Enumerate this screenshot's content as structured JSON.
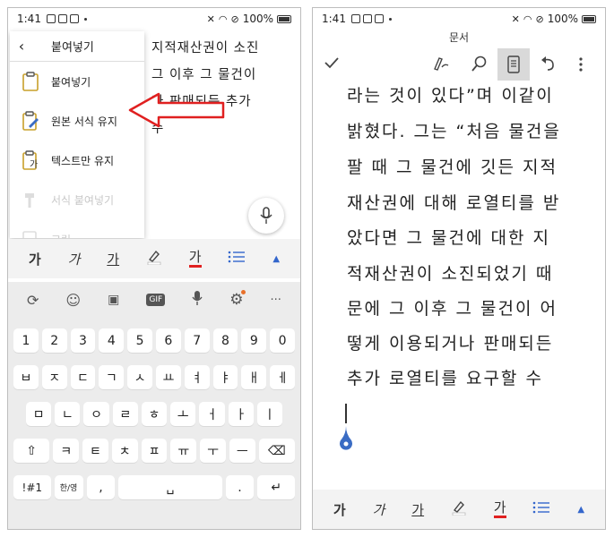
{
  "status_bar": {
    "time": "1:41",
    "battery": "100%"
  },
  "left_screen": {
    "doc_lines": [
      "지적재산권이 소진",
      "그 이후 그 물건이",
      "나 판매되든 추가",
      "수"
    ],
    "paste_menu": {
      "back_icon": "back-arrow-icon",
      "title": "붙여넣기",
      "items": [
        {
          "label": "붙여넣기",
          "icon": "clipboard-icon",
          "enabled": true
        },
        {
          "label": "원본 서식 유지",
          "icon": "clipboard-format-icon",
          "enabled": true
        },
        {
          "label": "텍스트만 유지",
          "icon": "clipboard-text-icon",
          "enabled": true
        },
        {
          "label": "서식 붙여넣기",
          "icon": "format-painter-icon",
          "enabled": false
        },
        {
          "label": "그림",
          "icon": "clipboard-image-icon",
          "enabled": false
        }
      ]
    },
    "annotation_arrow_color": "#e02020",
    "keyboard": {
      "toolbar_icons": [
        "rotate-icon",
        "emoji-icon",
        "sticker-icon",
        "gif-icon",
        "mic-icon",
        "gear-icon",
        "more-icon"
      ],
      "gif_label": "GIF",
      "more_label": "···",
      "rows": [
        [
          "1",
          "2",
          "3",
          "4",
          "5",
          "6",
          "7",
          "8",
          "9",
          "0"
        ],
        [
          "ㅂ",
          "ㅈ",
          "ㄷ",
          "ㄱ",
          "ㅅ",
          "ㅛ",
          "ㅕ",
          "ㅑ",
          "ㅐ",
          "ㅔ"
        ],
        [
          "ㅁ",
          "ㄴ",
          "ㅇ",
          "ㄹ",
          "ㅎ",
          "ㅗ",
          "ㅓ",
          "ㅏ",
          "ㅣ"
        ],
        [
          "⇧",
          "ㅋ",
          "ㅌ",
          "ㅊ",
          "ㅍ",
          "ㅠ",
          "ㅜ",
          "ㅡ",
          "⌫"
        ],
        [
          "!#1",
          "한/영",
          ",",
          "␣",
          ".",
          "↵"
        ]
      ]
    }
  },
  "format_bar": {
    "bold": "가",
    "italic": "가",
    "underline": "가",
    "color": "가",
    "list_icon": "list-icon",
    "expand_icon": "▲"
  },
  "right_screen": {
    "title": "문서",
    "toolbar_icons": [
      "check-icon",
      "pen-icon",
      "search-icon",
      "reading-view-icon",
      "undo-icon",
      "more-vert-icon"
    ],
    "lines": [
      "라는 것이 있다”며 이같이",
      "밝혔다. 그는 “처음 물건을",
      "팔 때 그 물건에 깃든 지적",
      "재산권에 대해 로열티를 받",
      "았다면 그 물건에 대한 지",
      "적재산권이 소진되었기 때",
      "문에 그 이후 그 물건이 어",
      "떻게 이용되거나 판매되든",
      "추가 로열티를 요구할 수"
    ],
    "cursor_handle_color": "#3a6cc4"
  }
}
